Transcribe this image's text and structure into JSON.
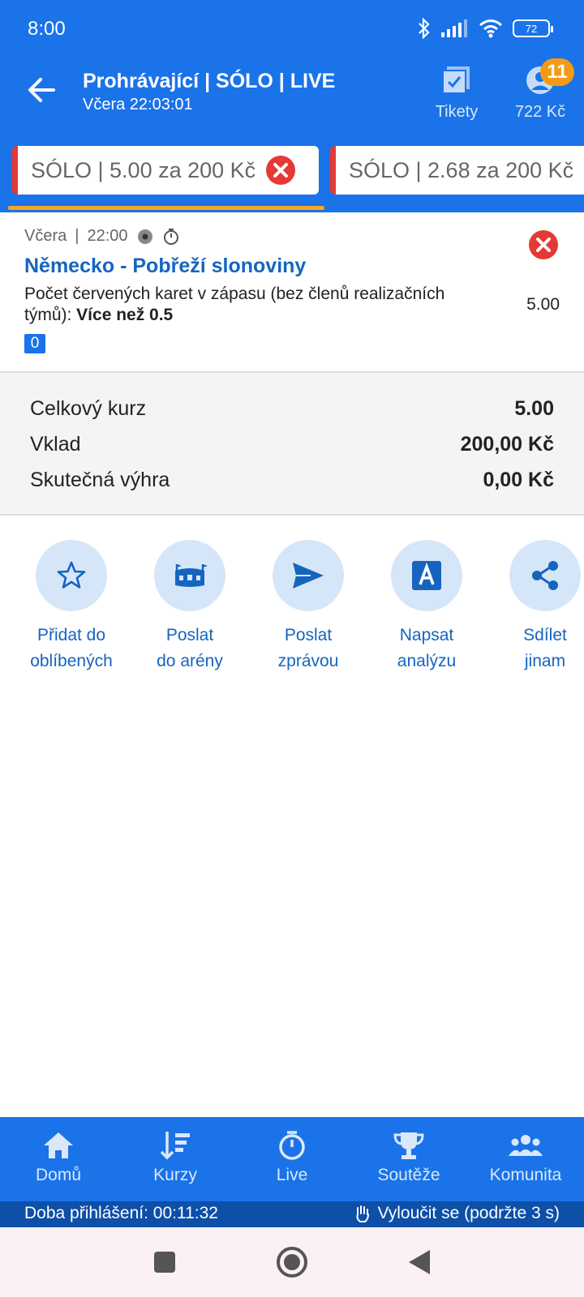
{
  "status": {
    "time": "8:00",
    "battery": "72"
  },
  "header": {
    "title": "Prohrávající | SÓLO | LIVE",
    "subtitle": "Včera 22:03:01",
    "tickets_label": "Tikety",
    "balance": "722 Kč",
    "badge_count": "11"
  },
  "tabs": [
    {
      "label": "SÓLO  | 5.00 za 200 Kč"
    },
    {
      "label": "SÓLO  | 2.68 za 200 Kč"
    }
  ],
  "event": {
    "day": "Včera",
    "time": "22:00",
    "match": "Německo - Pobřeží slonoviny",
    "market": "Počet červených karet v zápasu (bez členů realizačních týmů): ",
    "selection": "Více než 0.5",
    "odd": "5.00",
    "badge": "0"
  },
  "summary": {
    "total_odds_label": "Celkový kurz",
    "total_odds": "5.00",
    "stake_label": "Vklad",
    "stake": "200,00 Kč",
    "win_label": "Skutečná výhra",
    "win": "0,00 Kč"
  },
  "actions": [
    {
      "line1": "Přidat do",
      "line2": "oblíbených",
      "icon": "star-icon"
    },
    {
      "line1": "Poslat",
      "line2": "do arény",
      "icon": "arena-icon"
    },
    {
      "line1": "Poslat",
      "line2": "zprávou",
      "icon": "send-icon"
    },
    {
      "line1": "Napsat",
      "line2": "analýzu",
      "icon": "analysis-icon"
    },
    {
      "line1": "Sdílet",
      "line2": "jinam",
      "icon": "share-icon"
    }
  ],
  "nav": [
    {
      "label": "Domů",
      "icon": "home-icon"
    },
    {
      "label": "Kurzy",
      "icon": "odds-icon"
    },
    {
      "label": "Live",
      "icon": "stopwatch-icon"
    },
    {
      "label": "Soutěže",
      "icon": "trophy-icon"
    },
    {
      "label": "Komunita",
      "icon": "community-icon"
    }
  ],
  "session": {
    "login_time": "Doba přihlášení: 00:11:32",
    "exclude": "Vyloučit se (podržte 3 s)"
  },
  "colors": {
    "primary": "#1a73e8",
    "accent": "#f5a623",
    "danger": "#e53935",
    "link": "#1565c0"
  }
}
